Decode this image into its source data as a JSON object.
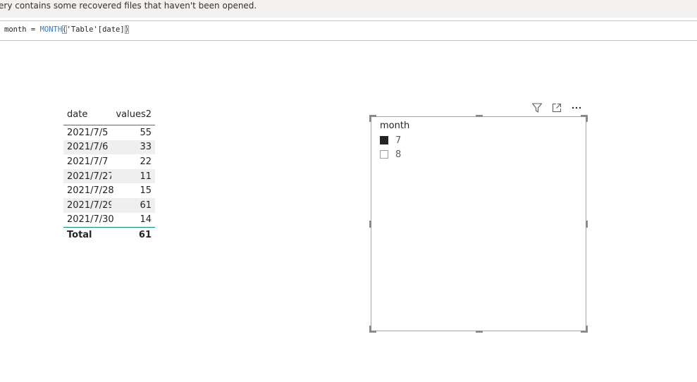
{
  "notice": {
    "text": "ery contains some recovered files that haven't been opened."
  },
  "formula": {
    "prefix": "month = ",
    "function": "MONTH",
    "open_paren": "(",
    "argument": "'Table'[date]",
    "close_paren": ")"
  },
  "table": {
    "headers": [
      "date",
      "values2"
    ],
    "rows": [
      {
        "date": "2021/7/5",
        "value": "55"
      },
      {
        "date": "2021/7/6",
        "value": "33"
      },
      {
        "date": "2021/7/7",
        "value": "22"
      },
      {
        "date": "2021/7/27",
        "value": "11"
      },
      {
        "date": "2021/7/28",
        "value": "15"
      },
      {
        "date": "2021/7/29",
        "value": "61"
      },
      {
        "date": "2021/7/30",
        "value": "14"
      }
    ],
    "total_label": "Total",
    "total_value": "61"
  },
  "slicer": {
    "title": "month",
    "items": [
      {
        "label": "7",
        "checked": true
      },
      {
        "label": "8",
        "checked": false
      }
    ],
    "toolbar_icons": [
      "filter-icon",
      "focus-mode-icon",
      "more-options-icon"
    ]
  }
}
